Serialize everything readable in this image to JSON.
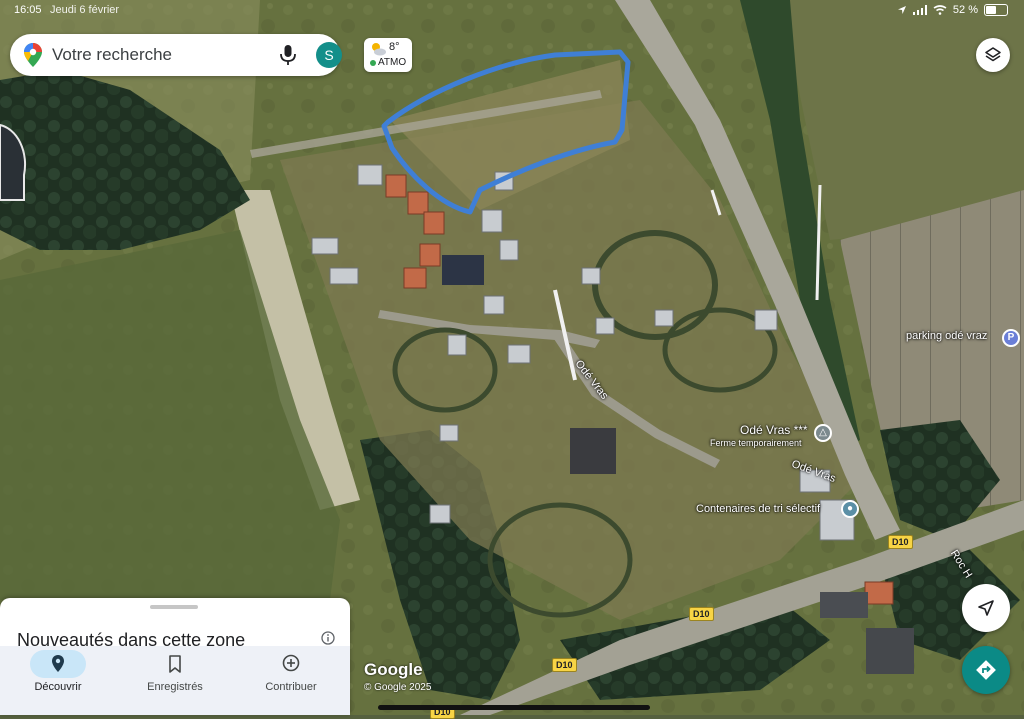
{
  "status_bar": {
    "time": "16:05",
    "date": "Jeudi 6 février",
    "battery": "52 %",
    "battery_level": 0.52
  },
  "search": {
    "placeholder": "Votre recherche",
    "avatar_letter": "S",
    "icons": [
      "google-maps-pin-icon",
      "mic-icon"
    ]
  },
  "weather": {
    "temperature": "8°",
    "air_quality_label": "ATMO",
    "icon": "partly-cloudy-icon"
  },
  "map": {
    "type": "satellite",
    "labels": {
      "parking": "parking odé vraz",
      "road_ode_vras_1": "Odé Vras",
      "road_ode_vras_2": "Odé Vras",
      "campsite_name": "Odé Vras ***",
      "campsite_status": "Ferme temporairement",
      "recycling": "Contenaires de tri sélectif",
      "road_roc_h": "Roc H"
    },
    "road_shields": [
      "D10",
      "D10",
      "D10",
      "D10"
    ],
    "colors": {
      "route_highlight": "#3f7fd6",
      "pin_parking": "#6b7fd7",
      "pin_camping": "#7c8a8e",
      "pin_recycling": "#5b8fa6",
      "accent": "#0b8a86"
    }
  },
  "controls": {
    "layers_icon": "layers-icon",
    "locate_icon": "navigation-arrow-icon",
    "directions_icon": "directions-icon"
  },
  "sheet": {
    "title": "Nouveautés dans cette zone"
  },
  "bottom_nav": {
    "items": [
      {
        "label": "Découvrir",
        "icon": "location-pin-icon",
        "active": true
      },
      {
        "label": "Enregistrés",
        "icon": "bookmark-icon",
        "active": false
      },
      {
        "label": "Contribuer",
        "icon": "add-circle-icon",
        "active": false
      }
    ]
  },
  "attribution": {
    "logo": "Google",
    "copyright": "© Google 2025"
  }
}
